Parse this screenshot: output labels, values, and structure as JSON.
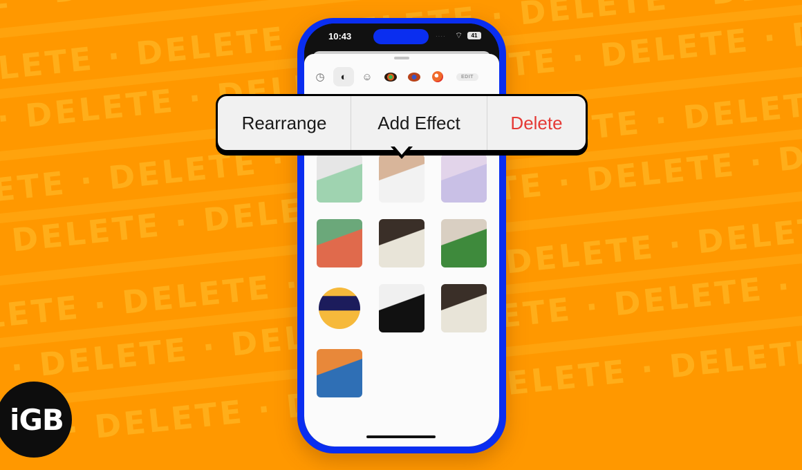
{
  "background": {
    "watermark_word": "DELETE · DELETE · DELETE · DELETE · DELETE · DELETE",
    "color": "#ff9800"
  },
  "brand": {
    "logo_text": "iGB"
  },
  "status_bar": {
    "time": "10:43",
    "battery": "41",
    "signal": "····",
    "wifi": "wifi-icon"
  },
  "sticker_drawer": {
    "tabs": [
      {
        "name": "recents",
        "icon": "clock-icon",
        "glyph": "◷"
      },
      {
        "name": "stickers",
        "icon": "sticker-peel-icon",
        "glyph": "◐",
        "active": true
      },
      {
        "name": "emoji",
        "icon": "smiley-icon",
        "glyph": "☺"
      },
      {
        "name": "app-1",
        "icon": "app-icon-ring",
        "color": "#2a1a10"
      },
      {
        "name": "app-2",
        "icon": "app-icon-game",
        "color": "#b8431b"
      },
      {
        "name": "app-3",
        "icon": "app-icon-flame",
        "color": "#f06a2a"
      }
    ],
    "edit_label": "EDIT"
  },
  "context_menu": {
    "items": [
      {
        "label": "Rearrange",
        "destructive": false
      },
      {
        "label": "Add Effect",
        "destructive": false
      },
      {
        "label": "Delete",
        "destructive": true
      }
    ],
    "danger_color": "#e53935"
  },
  "stickers": [
    {
      "name": "two-men-selfie",
      "colors": [
        "#9fd3b0",
        "#e6e6e6"
      ]
    },
    {
      "name": "man-white-tshirt",
      "colors": [
        "#f2f2f2",
        "#d8b59a"
      ]
    },
    {
      "name": "man-lavender-shirt",
      "colors": [
        "#c9c0e6",
        "#e2d4ea"
      ]
    },
    {
      "name": "motorcycle",
      "colors": [
        "#e06a4c",
        "#6ba87a"
      ]
    },
    {
      "name": "man-seated-glasses",
      "colors": [
        "#e8e4d8",
        "#3a2f28"
      ]
    },
    {
      "name": "potted-plant",
      "colors": [
        "#3e8a3c",
        "#d9cfc2"
      ]
    },
    {
      "name": "vr-goggles-emoji",
      "colors": [
        "#f6b93b",
        "#1c1c5c"
      ]
    },
    {
      "name": "bottle-in-hand",
      "colors": [
        "#111111",
        "#f0f0f0"
      ]
    },
    {
      "name": "man-seated-side",
      "colors": [
        "#e8e4d8",
        "#3a2f28"
      ]
    },
    {
      "name": "monk-figurines",
      "colors": [
        "#2f6fb5",
        "#e8883a"
      ]
    }
  ]
}
